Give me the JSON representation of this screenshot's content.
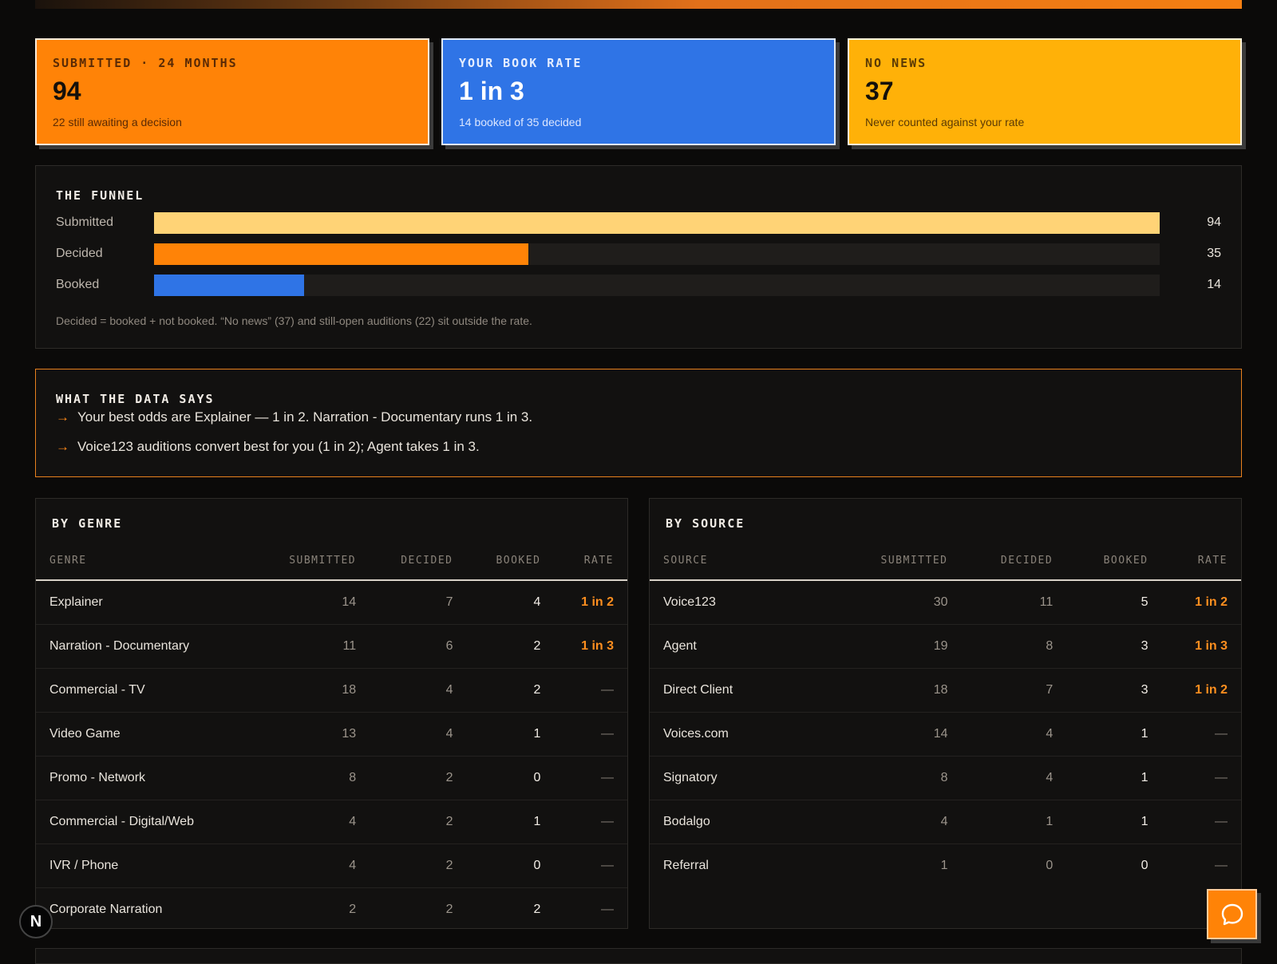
{
  "stats": [
    {
      "label": "SUBMITTED · 24 MONTHS",
      "value": "94",
      "sub": "22 still awaiting a decision"
    },
    {
      "label": "YOUR BOOK RATE",
      "value": "1 in 3",
      "sub": "14 booked of 35 decided"
    },
    {
      "label": "NO NEWS",
      "value": "37",
      "sub": "Never counted against your rate"
    }
  ],
  "funnel": {
    "title": "THE FUNNEL",
    "rows": [
      {
        "label": "Submitted",
        "value": "94"
      },
      {
        "label": "Decided",
        "value": "35"
      },
      {
        "label": "Booked",
        "value": "14"
      }
    ],
    "max": 94,
    "note": "Decided = booked + not booked. “No news” (37) and still-open auditions (22) sit outside the rate."
  },
  "insights": {
    "title": "WHAT THE DATA SAYS",
    "items": [
      "Your best odds are Explainer — 1 in 2. Narration - Documentary runs 1 in 3.",
      "Voice123 auditions convert best for you (1 in 2); Agent takes 1 in 3."
    ]
  },
  "by_genre": {
    "title": "BY GENRE",
    "headers": [
      "GENRE",
      "SUBMITTED",
      "DECIDED",
      "BOOKED",
      "RATE"
    ],
    "rows": [
      [
        "Explainer",
        "14",
        "7",
        "4",
        "1 in 2"
      ],
      [
        "Narration - Documentary",
        "11",
        "6",
        "2",
        "1 in 3"
      ],
      [
        "Commercial - TV",
        "18",
        "4",
        "2",
        "—"
      ],
      [
        "Video Game",
        "13",
        "4",
        "1",
        "—"
      ],
      [
        "Promo - Network",
        "8",
        "2",
        "0",
        "—"
      ],
      [
        "Commercial - Digital/Web",
        "4",
        "2",
        "1",
        "—"
      ],
      [
        "IVR / Phone",
        "4",
        "2",
        "0",
        "—"
      ],
      [
        "Corporate Narration",
        "2",
        "2",
        "2",
        "—"
      ]
    ]
  },
  "by_source": {
    "title": "BY SOURCE",
    "headers": [
      "SOURCE",
      "SUBMITTED",
      "DECIDED",
      "BOOKED",
      "RATE"
    ],
    "rows": [
      [
        "Voice123",
        "30",
        "11",
        "5",
        "1 in 2"
      ],
      [
        "Agent",
        "19",
        "8",
        "3",
        "1 in 3"
      ],
      [
        "Direct Client",
        "18",
        "7",
        "3",
        "1 in 2"
      ],
      [
        "Voices.com",
        "14",
        "4",
        "1",
        "—"
      ],
      [
        "Signatory",
        "8",
        "4",
        "1",
        "—"
      ],
      [
        "Bodalgo",
        "4",
        "1",
        "1",
        "—"
      ],
      [
        "Referral",
        "1",
        "0",
        "0",
        "—"
      ]
    ]
  },
  "badge": {
    "letter": "N"
  },
  "chat": {
    "icon": "chat-bubble-icon"
  },
  "colors": {
    "orange": "#ff8307",
    "blue": "#2f74e6",
    "yellow": "#ffb108",
    "submitted_bar": "#ffd376"
  }
}
